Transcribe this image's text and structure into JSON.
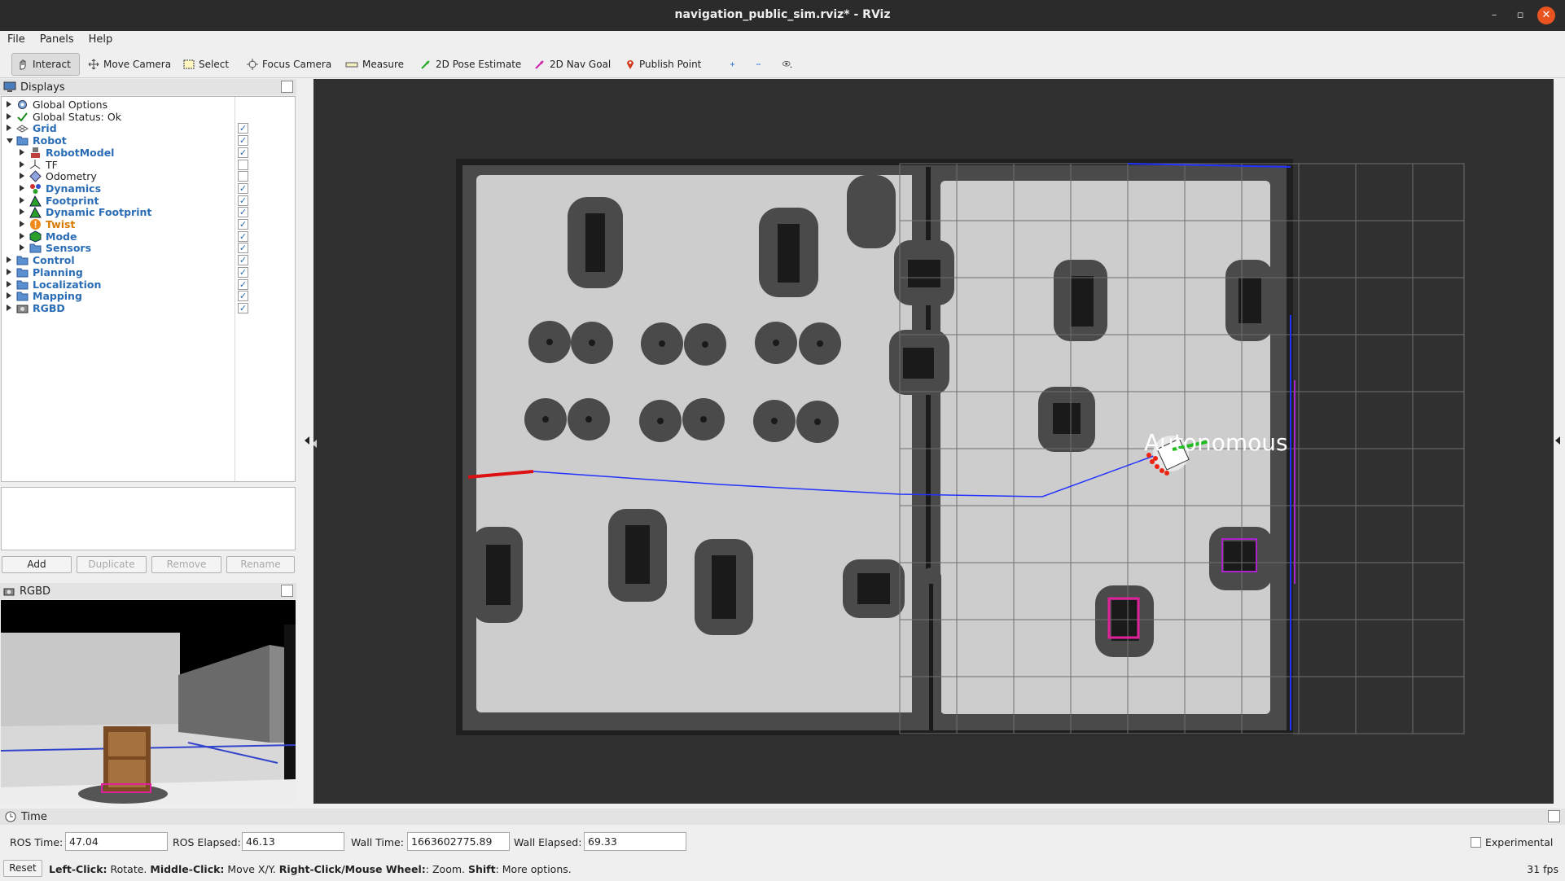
{
  "window": {
    "title": "navigation_public_sim.rviz* - RViz",
    "controls": [
      "–",
      "▫",
      "✕"
    ]
  },
  "menu": [
    "File",
    "Panels",
    "Help"
  ],
  "toolbar": [
    {
      "label": "Interact",
      "icon": "interact-icon"
    },
    {
      "label": "Move Camera",
      "icon": "move-camera-icon"
    },
    {
      "label": "Select",
      "icon": "select-icon"
    },
    {
      "label": "Focus Camera",
      "icon": "focus-camera-icon"
    },
    {
      "label": "Measure",
      "icon": "measure-icon"
    },
    {
      "label": "2D Pose Estimate",
      "icon": "pose-estimate-icon"
    },
    {
      "label": "2D Nav Goal",
      "icon": "nav-goal-icon"
    },
    {
      "label": "Publish Point",
      "icon": "publish-point-icon"
    }
  ],
  "displays": {
    "title": "Displays",
    "items": [
      {
        "label": "Global Options",
        "level": 0,
        "expand": "right",
        "style": "normal",
        "checked": null,
        "icon": "gear-icon"
      },
      {
        "label": "Global Status: Ok",
        "level": 0,
        "expand": "right",
        "style": "normal",
        "checked": null,
        "icon": "check-icon"
      },
      {
        "label": "Grid",
        "level": 0,
        "expand": "right",
        "style": "blue",
        "checked": true,
        "icon": "grid-icon"
      },
      {
        "label": "Robot",
        "level": 0,
        "expand": "down",
        "style": "blue",
        "checked": true,
        "icon": "folder-icon"
      },
      {
        "label": "RobotModel",
        "level": 1,
        "expand": "right",
        "style": "blue",
        "checked": true,
        "icon": "robot-model-icon"
      },
      {
        "label": "TF",
        "level": 1,
        "expand": "right",
        "style": "normal",
        "checked": false,
        "icon": "tf-icon"
      },
      {
        "label": "Odometry",
        "level": 1,
        "expand": "right",
        "style": "normal",
        "checked": false,
        "icon": "odometry-icon"
      },
      {
        "label": "Dynamics",
        "level": 1,
        "expand": "right",
        "style": "blue",
        "checked": true,
        "icon": "dynamics-icon"
      },
      {
        "label": "Footprint",
        "level": 1,
        "expand": "right",
        "style": "blue",
        "checked": true,
        "icon": "footprint-icon"
      },
      {
        "label": "Dynamic Footprint",
        "level": 1,
        "expand": "right",
        "style": "blue",
        "checked": true,
        "icon": "footprint-icon"
      },
      {
        "label": "Twist",
        "level": 1,
        "expand": "right",
        "style": "orange",
        "checked": true,
        "icon": "warning-icon"
      },
      {
        "label": "Mode",
        "level": 1,
        "expand": "right",
        "style": "blue",
        "checked": true,
        "icon": "mode-icon"
      },
      {
        "label": "Sensors",
        "level": 1,
        "expand": "right",
        "style": "blue",
        "checked": true,
        "icon": "folder-icon"
      },
      {
        "label": "Control",
        "level": 0,
        "expand": "right",
        "style": "blue",
        "checked": true,
        "icon": "folder-icon"
      },
      {
        "label": "Planning",
        "level": 0,
        "expand": "right",
        "style": "blue",
        "checked": true,
        "icon": "folder-icon"
      },
      {
        "label": "Localization",
        "level": 0,
        "expand": "right",
        "style": "blue",
        "checked": true,
        "icon": "folder-icon"
      },
      {
        "label": "Mapping",
        "level": 0,
        "expand": "right",
        "style": "blue",
        "checked": true,
        "icon": "folder-icon"
      },
      {
        "label": "RGBD",
        "level": 0,
        "expand": "right",
        "style": "blue",
        "checked": true,
        "icon": "camera-icon"
      }
    ],
    "buttons": {
      "add": "Add",
      "duplicate": "Duplicate",
      "remove": "Remove",
      "rename": "Rename"
    }
  },
  "rgbd": {
    "title": "RGBD"
  },
  "view": {
    "robot_label": "Autonomous"
  },
  "time": {
    "title": "Time",
    "ros_time_label": "ROS Time:",
    "ros_time": "47.04",
    "ros_elapsed_label": "ROS Elapsed:",
    "ros_elapsed": "46.13",
    "wall_time_label": "Wall Time:",
    "wall_time": "1663602775.89",
    "wall_elapsed_label": "Wall Elapsed:",
    "wall_elapsed": "69.33",
    "experimental_label": "Experimental"
  },
  "status": {
    "reset": "Reset",
    "left_click": "Left-Click:",
    "left_click_text": " Rotate. ",
    "middle_click": "Middle-Click:",
    "middle_click_text": " Move X/Y. ",
    "right_click": "Right-Click/Mouse Wheel:",
    "right_click_text": ": Zoom. ",
    "shift": "Shift",
    "shift_text": ": More options.",
    "fps": "31 fps"
  },
  "colors": {
    "background": "#303030",
    "free_space": "#cdcdcd",
    "inflation": "#4a4a4a",
    "path": "#2244ff",
    "accent_blue": "#2a6db5",
    "warning_orange": "#d97a00"
  }
}
